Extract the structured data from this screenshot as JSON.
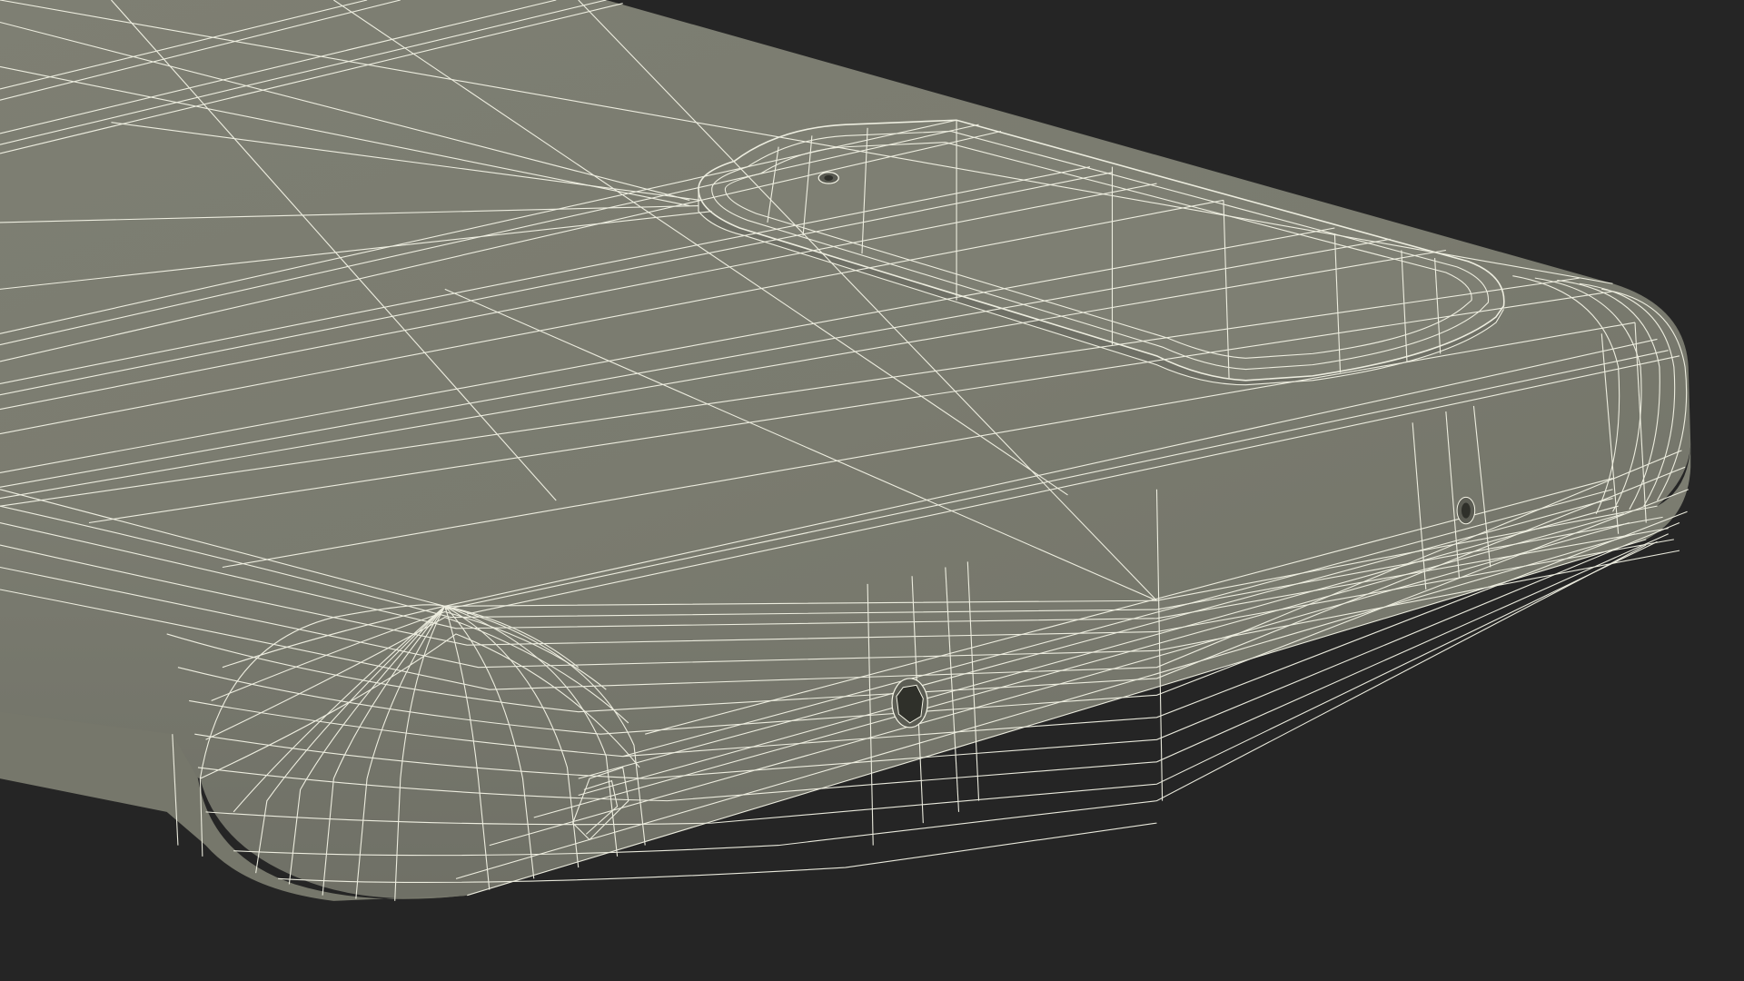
{
  "scene": {
    "subject": "phone-wireframe-render",
    "colors": {
      "background": "#252525",
      "surface": "#7b7c70",
      "surface_dark": "#6f7065",
      "surface_light": "#85867a",
      "wire": "#f4f4e6",
      "hole": "#2f302a"
    }
  }
}
